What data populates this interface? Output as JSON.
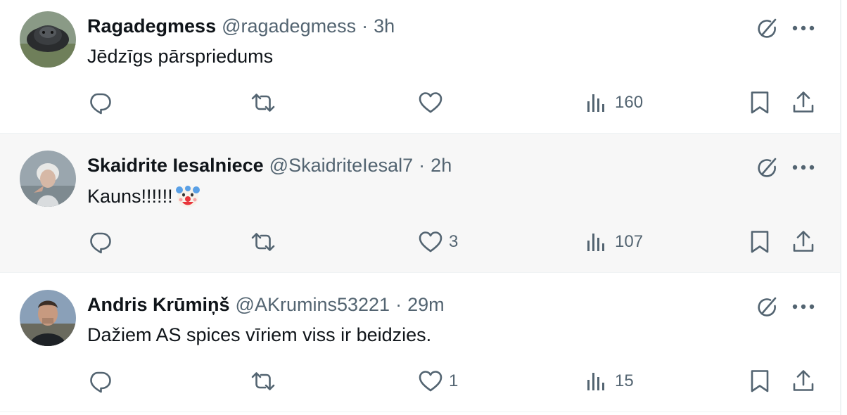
{
  "tweets": [
    {
      "name": "Ragadegmess",
      "handle": "@ragadegmess",
      "separator": "·",
      "time": "3h",
      "text": "Jēdzīgs pārspriedums",
      "emoji": "",
      "replies": "",
      "reposts": "",
      "likes": "",
      "views": "160",
      "avatar": "seal-avatar"
    },
    {
      "name": "Skaidrite Iesalniece",
      "handle": "@SkaidriteIesal7",
      "separator": "·",
      "time": "2h",
      "text": "Kauns!!!!!!",
      "emoji": "clown-face-emoji",
      "replies": "",
      "reposts": "",
      "likes": "3",
      "views": "107",
      "avatar": "woman-avatar"
    },
    {
      "name": "Andris Krūmiņš",
      "handle": "@AKrumins53221",
      "separator": "·",
      "time": "29m",
      "text": "Dažiem AS spices vīriem viss ir beidzies.",
      "emoji": "",
      "replies": "",
      "reposts": "",
      "likes": "1",
      "views": "15",
      "avatar": "man-avatar"
    }
  ],
  "colors": {
    "text": "#0f1419",
    "secondary": "#536471",
    "divider": "#eff3f4",
    "hover_bg": "#f7f7f7"
  },
  "icons": [
    "reply-icon",
    "repost-icon",
    "like-icon",
    "views-icon",
    "bookmark-icon",
    "share-icon",
    "grok-icon",
    "more-icon"
  ]
}
